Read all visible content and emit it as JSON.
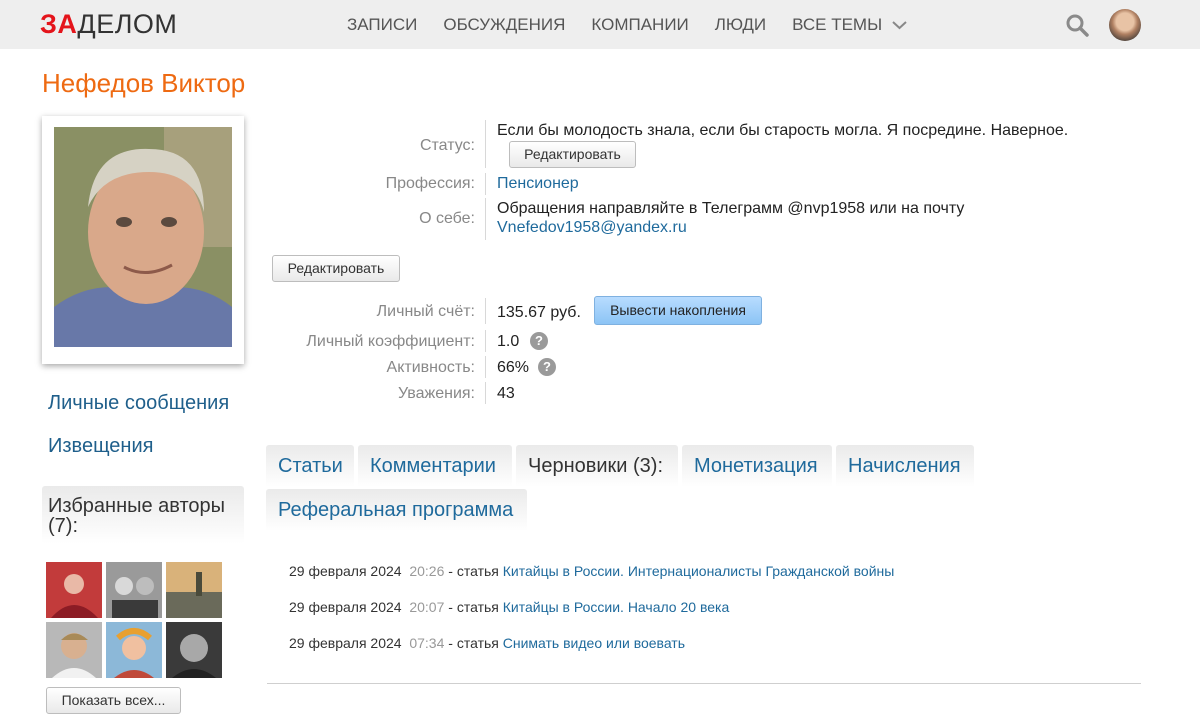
{
  "header": {
    "logo_red": "ЗА",
    "logo_dark": "ДЕЛОМ",
    "nav": [
      "ЗАПИСИ",
      "ОБСУЖДЕНИЯ",
      "КОМПАНИИ",
      "ЛЮДИ",
      "ВСЕ ТЕМЫ"
    ]
  },
  "profile": {
    "name": "Нефедов Виктор",
    "links": [
      "Личные сообщения",
      "Извещения"
    ],
    "favorites_title": "Избранные авторы (7):",
    "show_all_label": "Показать всех..."
  },
  "info": {
    "status_label": "Статус:",
    "status_value": "Если бы молодость знала, если бы старость могла. Я посредине. Наверное.",
    "edit_status_label": "Редактировать",
    "profession_label": "Профессия:",
    "profession_value": "Пенсионер",
    "about_label": "О себе:",
    "about_line1": "Обращения направляйте в Телеграмм @nvp1958 или на почту",
    "about_email": "Vnefedov1958@yandex.ru",
    "edit_label": "Редактировать",
    "account_label": "Личный счёт:",
    "account_value": "135.67 руб.",
    "withdraw_label": "Вывести накопления",
    "coef_label": "Личный коэффициент:",
    "coef_value": "1.0",
    "activity_label": "Активность:",
    "activity_value": "66%",
    "respect_label": "Уважения:",
    "respect_value": "43"
  },
  "tabs": [
    "Статьи",
    "Комментарии",
    "Черновики (3):",
    "Монетизация",
    "Начисления",
    "Реферальная программа"
  ],
  "active_tab": "Черновики (3):",
  "drafts": [
    {
      "date": "29 февраля 2024",
      "time": "20:26",
      "type": "- статья",
      "title": "Китайцы в России. Интернационалисты Гражданской войны"
    },
    {
      "date": "29 февраля 2024",
      "time": "20:07",
      "type": "- статья",
      "title": "Китайцы в России. Начало 20 века"
    },
    {
      "date": "29 февраля 2024",
      "time": "07:34",
      "type": "- статья",
      "title": "Снимать видео или воевать"
    }
  ],
  "colors": {
    "accent": "#ee6a12",
    "link": "#1f6a9c",
    "logo_red": "#e4141b",
    "button_blue": "#8cc4f5"
  }
}
